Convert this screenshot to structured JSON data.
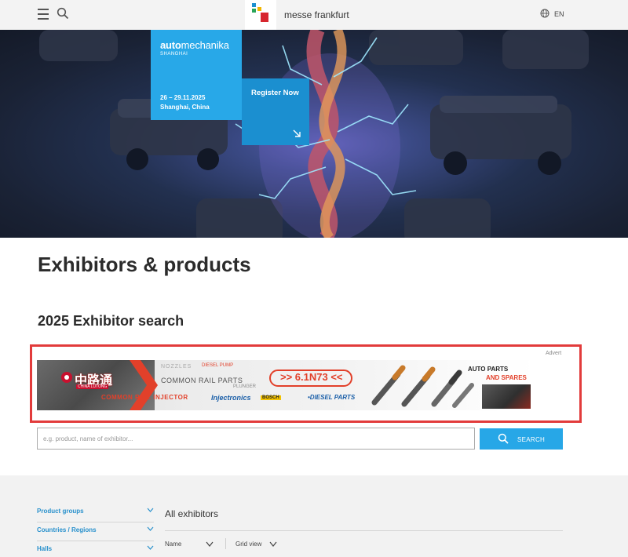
{
  "header": {
    "brand": "messe frankfurt",
    "language": "EN",
    "icons": [
      "menu-icon",
      "search-icon",
      "globe-icon"
    ]
  },
  "hero": {
    "event_name_bold": "auto",
    "event_name_rest": "mechanika",
    "event_sub": "SHANGHAI",
    "dates": "26 – 29.11.2025",
    "location": "Shanghai, China",
    "register_label": "Register Now"
  },
  "page": {
    "title": "Exhibitors & products",
    "section_title": "2025 Exhibitor search"
  },
  "advert": {
    "label": "Advert",
    "brand": "中路通",
    "brand_sub": "CHINA LUTONG",
    "nozzles": "NOZZLES",
    "diesel_pump": "DIESEL PUMP",
    "common_rail_parts": "COMMON RAIL PARTS",
    "plunger": "PLUNGER",
    "common_rail_injector": "COMMON RAIL INJECTOR",
    "injectronics": "Injectronics",
    "bosch": "BOSCH",
    "diesel_parts": "•DIESEL PARTS",
    "code": ">> 6.1N73 <<",
    "auto_parts": "AUTO PARTS",
    "and_spares": "AND SPARES"
  },
  "search": {
    "placeholder": "e.g. product, name of exhibitor...",
    "value": "",
    "button_label": "SEARCH"
  },
  "filters": {
    "items": [
      {
        "label": "Product groups"
      },
      {
        "label": "Countries / Regions"
      },
      {
        "label": "Halls"
      }
    ]
  },
  "results": {
    "heading": "All exhibitors",
    "sort_label": "Name",
    "view_label": "Grid view"
  },
  "colors": {
    "accent": "#27a7e7",
    "register": "#1b8fd0",
    "ad_frame": "#e23b3b",
    "filter_link": "#2790cc"
  }
}
